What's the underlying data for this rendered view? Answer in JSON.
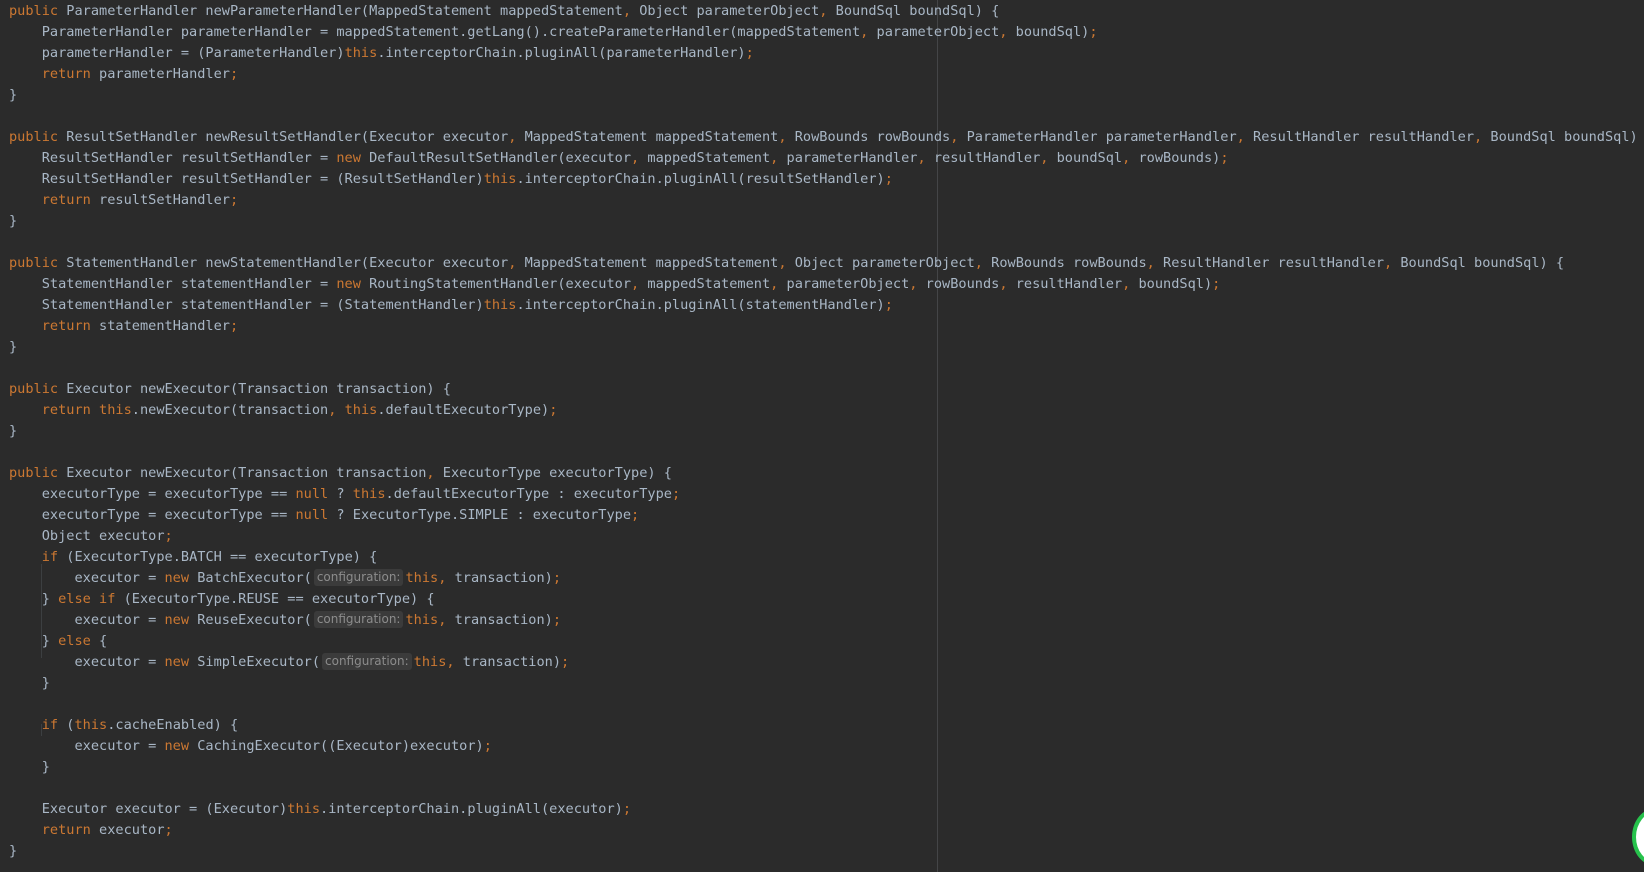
{
  "editor": {
    "colors": {
      "background": "#2b2b2b",
      "text": "#a9b7c6",
      "keyword": "#cc7832",
      "hint_text": "#8c8c8c",
      "hint_background": "#3b3b3b",
      "assistant_badge_ring": "#27c24c"
    },
    "lines": [
      [
        [
          "k",
          "public"
        ],
        [
          "t",
          " ParameterHandler newParameterHandler(MappedStatement mappedStatement"
        ],
        [
          "p",
          ","
        ],
        [
          "t",
          " Object parameterObject"
        ],
        [
          "p",
          ","
        ],
        [
          "t",
          " BoundSql boundSql) {"
        ]
      ],
      [
        [
          "t",
          "    ParameterHandler parameterHandler = mappedStatement.getLang().createParameterHandler(mappedStatement"
        ],
        [
          "p",
          ","
        ],
        [
          "t",
          " parameterObject"
        ],
        [
          "p",
          ","
        ],
        [
          "t",
          " boundSql)"
        ],
        [
          "p",
          ";"
        ]
      ],
      [
        [
          "t",
          "    parameterHandler = (ParameterHandler)"
        ],
        [
          "k",
          "this"
        ],
        [
          "t",
          ".interceptorChain.pluginAll(parameterHandler)"
        ],
        [
          "p",
          ";"
        ]
      ],
      [
        [
          "t",
          "    "
        ],
        [
          "k",
          "return"
        ],
        [
          "t",
          " parameterHandler"
        ],
        [
          "p",
          ";"
        ]
      ],
      [
        [
          "t",
          "}"
        ]
      ],
      [],
      [
        [
          "k",
          "public"
        ],
        [
          "t",
          " ResultSetHandler newResultSetHandler(Executor executor"
        ],
        [
          "p",
          ","
        ],
        [
          "t",
          " MappedStatement mappedStatement"
        ],
        [
          "p",
          ","
        ],
        [
          "t",
          " RowBounds rowBounds"
        ],
        [
          "p",
          ","
        ],
        [
          "t",
          " ParameterHandler parameterHandler"
        ],
        [
          "p",
          ","
        ],
        [
          "t",
          " ResultHandler resultHandler"
        ],
        [
          "p",
          ","
        ],
        [
          "t",
          " BoundSql boundSql) {"
        ]
      ],
      [
        [
          "t",
          "    ResultSetHandler resultSetHandler = "
        ],
        [
          "k",
          "new"
        ],
        [
          "t",
          " DefaultResultSetHandler(executor"
        ],
        [
          "p",
          ","
        ],
        [
          "t",
          " mappedStatement"
        ],
        [
          "p",
          ","
        ],
        [
          "t",
          " parameterHandler"
        ],
        [
          "p",
          ","
        ],
        [
          "t",
          " resultHandler"
        ],
        [
          "p",
          ","
        ],
        [
          "t",
          " boundSql"
        ],
        [
          "p",
          ","
        ],
        [
          "t",
          " rowBounds)"
        ],
        [
          "p",
          ";"
        ]
      ],
      [
        [
          "t",
          "    ResultSetHandler resultSetHandler = (ResultSetHandler)"
        ],
        [
          "k",
          "this"
        ],
        [
          "t",
          ".interceptorChain.pluginAll(resultSetHandler)"
        ],
        [
          "p",
          ";"
        ]
      ],
      [
        [
          "t",
          "    "
        ],
        [
          "k",
          "return"
        ],
        [
          "t",
          " resultSetHandler"
        ],
        [
          "p",
          ";"
        ]
      ],
      [
        [
          "t",
          "}"
        ]
      ],
      [],
      [
        [
          "k",
          "public"
        ],
        [
          "t",
          " StatementHandler newStatementHandler(Executor executor"
        ],
        [
          "p",
          ","
        ],
        [
          "t",
          " MappedStatement mappedStatement"
        ],
        [
          "p",
          ","
        ],
        [
          "t",
          " Object parameterObject"
        ],
        [
          "p",
          ","
        ],
        [
          "t",
          " RowBounds rowBounds"
        ],
        [
          "p",
          ","
        ],
        [
          "t",
          " ResultHandler resultHandler"
        ],
        [
          "p",
          ","
        ],
        [
          "t",
          " BoundSql boundSql) {"
        ]
      ],
      [
        [
          "t",
          "    StatementHandler statementHandler = "
        ],
        [
          "k",
          "new"
        ],
        [
          "t",
          " RoutingStatementHandler(executor"
        ],
        [
          "p",
          ","
        ],
        [
          "t",
          " mappedStatement"
        ],
        [
          "p",
          ","
        ],
        [
          "t",
          " parameterObject"
        ],
        [
          "p",
          ","
        ],
        [
          "t",
          " rowBounds"
        ],
        [
          "p",
          ","
        ],
        [
          "t",
          " resultHandler"
        ],
        [
          "p",
          ","
        ],
        [
          "t",
          " boundSql)"
        ],
        [
          "p",
          ";"
        ]
      ],
      [
        [
          "t",
          "    StatementHandler statementHandler = (StatementHandler)"
        ],
        [
          "k",
          "this"
        ],
        [
          "t",
          ".interceptorChain.pluginAll(statementHandler)"
        ],
        [
          "p",
          ";"
        ]
      ],
      [
        [
          "t",
          "    "
        ],
        [
          "k",
          "return"
        ],
        [
          "t",
          " statementHandler"
        ],
        [
          "p",
          ";"
        ]
      ],
      [
        [
          "t",
          "}"
        ]
      ],
      [],
      [
        [
          "k",
          "public"
        ],
        [
          "t",
          " Executor newExecutor(Transaction transaction) {"
        ]
      ],
      [
        [
          "t",
          "    "
        ],
        [
          "k",
          "return"
        ],
        [
          "t",
          " "
        ],
        [
          "k",
          "this"
        ],
        [
          "t",
          ".newExecutor(transaction"
        ],
        [
          "p",
          ","
        ],
        [
          "t",
          " "
        ],
        [
          "k",
          "this"
        ],
        [
          "t",
          ".defaultExecutorType)"
        ],
        [
          "p",
          ";"
        ]
      ],
      [
        [
          "t",
          "}"
        ]
      ],
      [],
      [
        [
          "k",
          "public"
        ],
        [
          "t",
          " Executor newExecutor(Transaction transaction"
        ],
        [
          "p",
          ","
        ],
        [
          "t",
          " ExecutorType executorType) {"
        ]
      ],
      [
        [
          "t",
          "    executorType = executorType == "
        ],
        [
          "k",
          "null"
        ],
        [
          "t",
          " ? "
        ],
        [
          "k",
          "this"
        ],
        [
          "t",
          ".defaultExecutorType : executorType"
        ],
        [
          "p",
          ";"
        ]
      ],
      [
        [
          "t",
          "    executorType = executorType == "
        ],
        [
          "k",
          "null"
        ],
        [
          "t",
          " ? ExecutorType.SIMPLE : executorType"
        ],
        [
          "p",
          ";"
        ]
      ],
      [
        [
          "t",
          "    Object executor"
        ],
        [
          "p",
          ";"
        ]
      ],
      [
        [
          "t",
          "    "
        ],
        [
          "k",
          "if"
        ],
        [
          "t",
          " (ExecutorType.BATCH == executorType) {"
        ]
      ],
      [
        [
          "t",
          "        executor = "
        ],
        [
          "k",
          "new"
        ],
        [
          "t",
          " BatchExecutor("
        ],
        [
          "h",
          "configuration:"
        ],
        [
          "k",
          "this"
        ],
        [
          "p",
          ","
        ],
        [
          "t",
          " transaction)"
        ],
        [
          "p",
          ";"
        ]
      ],
      [
        [
          "t",
          "    } "
        ],
        [
          "k",
          "else if"
        ],
        [
          "t",
          " (ExecutorType.REUSE == executorType) {"
        ]
      ],
      [
        [
          "t",
          "        executor = "
        ],
        [
          "k",
          "new"
        ],
        [
          "t",
          " ReuseExecutor("
        ],
        [
          "h",
          "configuration:"
        ],
        [
          "k",
          "this"
        ],
        [
          "p",
          ","
        ],
        [
          "t",
          " transaction)"
        ],
        [
          "p",
          ";"
        ]
      ],
      [
        [
          "t",
          "    } "
        ],
        [
          "k",
          "else"
        ],
        [
          "t",
          " {"
        ]
      ],
      [
        [
          "t",
          "        executor = "
        ],
        [
          "k",
          "new"
        ],
        [
          "t",
          " SimpleExecutor("
        ],
        [
          "h",
          "configuration:"
        ],
        [
          "k",
          "this"
        ],
        [
          "p",
          ","
        ],
        [
          "t",
          " transaction)"
        ],
        [
          "p",
          ";"
        ]
      ],
      [
        [
          "t",
          "    }"
        ]
      ],
      [],
      [
        [
          "t",
          "    "
        ],
        [
          "k",
          "if"
        ],
        [
          "t",
          " ("
        ],
        [
          "k",
          "this"
        ],
        [
          "t",
          ".cacheEnabled) {"
        ]
      ],
      [
        [
          "t",
          "        executor = "
        ],
        [
          "k",
          "new"
        ],
        [
          "t",
          " CachingExecutor((Executor)executor)"
        ],
        [
          "p",
          ";"
        ]
      ],
      [
        [
          "t",
          "    }"
        ]
      ],
      [],
      [
        [
          "t",
          "    Executor executor = (Executor)"
        ],
        [
          "k",
          "this"
        ],
        [
          "t",
          ".interceptorChain.pluginAll(executor)"
        ],
        [
          "p",
          ";"
        ]
      ],
      [
        [
          "t",
          "    "
        ],
        [
          "k",
          "return"
        ],
        [
          "t",
          " executor"
        ],
        [
          "p",
          ";"
        ]
      ],
      [
        [
          "t",
          "}"
        ]
      ]
    ]
  }
}
